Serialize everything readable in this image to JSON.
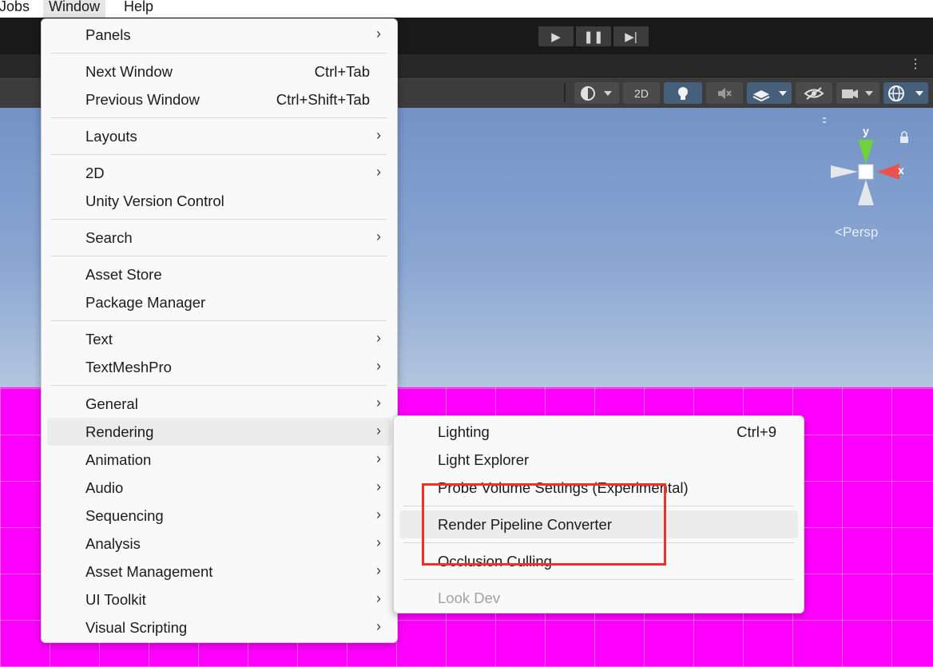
{
  "menubar": {
    "items": [
      "Jobs",
      "Window",
      "Help"
    ]
  },
  "playback": {
    "play": "▶",
    "pause": "❚❚",
    "step": "▶|"
  },
  "scene_toolbar": {
    "mode_2d": "2D",
    "kebab": "⋮"
  },
  "scene": {
    "persp_label": "Persp",
    "axis_x": "x",
    "axis_y": "y",
    "ground_color": "#ff00ff"
  },
  "window_menu": {
    "items": [
      {
        "label": "Panels",
        "submenu": true
      },
      {
        "label": "Next Window",
        "shortcut": "Ctrl+Tab"
      },
      {
        "label": "Previous Window",
        "shortcut": "Ctrl+Shift+Tab"
      },
      {
        "label": "Layouts",
        "submenu": true
      },
      {
        "label": "2D",
        "submenu": true
      },
      {
        "label": "Unity Version Control"
      },
      {
        "label": "Search",
        "submenu": true
      },
      {
        "label": "Asset Store"
      },
      {
        "label": "Package Manager"
      },
      {
        "label": "Text",
        "submenu": true
      },
      {
        "label": "TextMeshPro",
        "submenu": true
      },
      {
        "label": "General",
        "submenu": true
      },
      {
        "label": "Rendering",
        "submenu": true,
        "highlighted": true
      },
      {
        "label": "Animation",
        "submenu": true
      },
      {
        "label": "Audio",
        "submenu": true
      },
      {
        "label": "Sequencing",
        "submenu": true
      },
      {
        "label": "Analysis",
        "submenu": true
      },
      {
        "label": "Asset Management",
        "submenu": true
      },
      {
        "label": "UI Toolkit",
        "submenu": true
      },
      {
        "label": "Visual Scripting",
        "submenu": true
      }
    ]
  },
  "rendering_submenu": {
    "items": [
      {
        "label": "Lighting",
        "shortcut": "Ctrl+9"
      },
      {
        "label": "Light Explorer"
      },
      {
        "label": "Probe Volume Settings (Experimental)"
      },
      {
        "label": "Render Pipeline Converter",
        "highlighted": true
      },
      {
        "label": "Occlusion Culling"
      },
      {
        "label": "Look Dev",
        "disabled": true
      }
    ]
  },
  "colors": {
    "annotation": "#f0312b",
    "menu_bg": "#f9f9f9",
    "highlight": "#ececec",
    "toolbar_active": "#46607c"
  }
}
